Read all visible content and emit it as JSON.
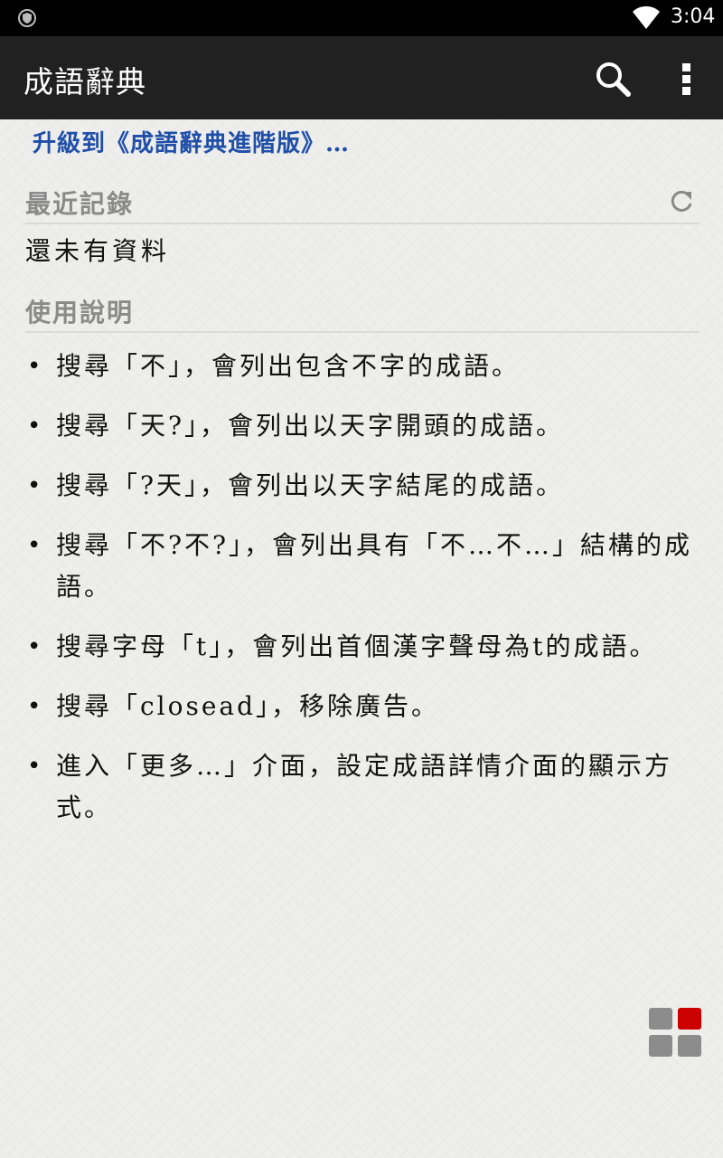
{
  "status_bar": {
    "time": "3:04",
    "left_icon": "shield-icon",
    "wifi_icon": "wifi-icon"
  },
  "app_bar": {
    "title": "成語辭典",
    "search_icon": "search-icon",
    "overflow_icon": "more-vert-icon"
  },
  "upgrade_link": "升級到《成語辭典進階版》…",
  "recent": {
    "title": "最近記錄",
    "refresh_icon": "refresh-icon",
    "empty_text": "還未有資料"
  },
  "help": {
    "title": "使用說明",
    "items": [
      "搜尋「不」，會列出包含不字的成語。",
      "搜尋「天?」，會列出以天字開頭的成語。",
      "搜尋「?天」，會列出以天字結尾的成語。",
      "搜尋「不?不?」，會列出具有「不…不…」結構的成語。",
      "搜尋字母「t」，會列出首個漢字聲母為t的成語。",
      "搜尋「closead」，移除廣告。",
      "進入「更多…」介面，設定成語詳情介面的顯示方式。"
    ]
  },
  "grid_button": {
    "icon": "grid-icon",
    "accent_color": "#cc0000",
    "square_color": "#8c8c8c"
  }
}
